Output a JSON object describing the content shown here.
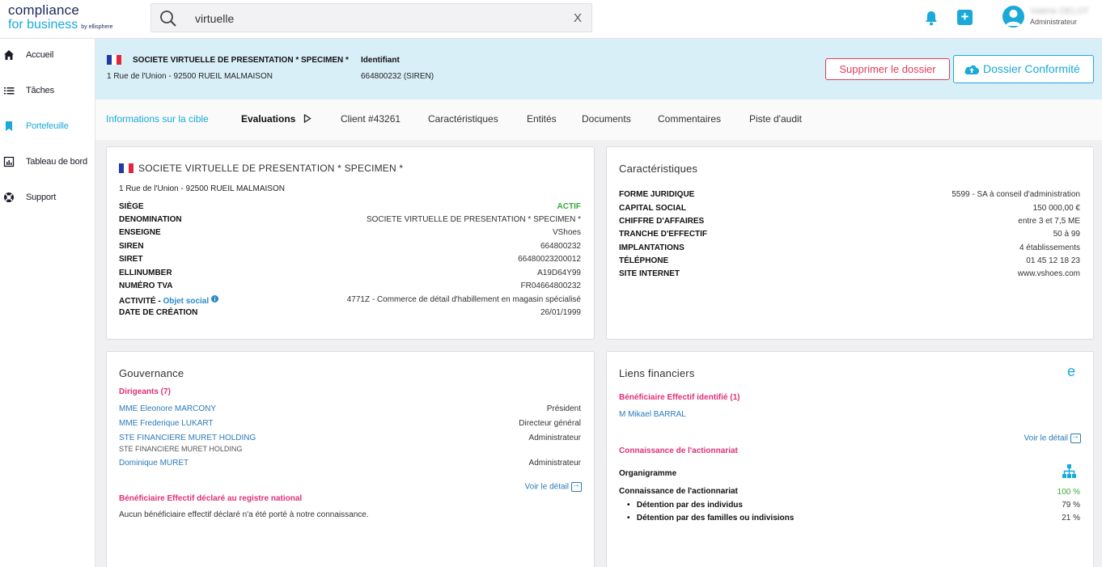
{
  "app": {
    "logo_line1": "compliance",
    "logo_line2": "for business",
    "logo_by": "by ellisphere"
  },
  "search": {
    "value": "virtuelle",
    "clear_label": "X"
  },
  "user": {
    "name": "Valérie DELOT",
    "role": "Administrateur"
  },
  "sidebar": {
    "items": [
      {
        "label": "Accueil",
        "icon": "home-icon"
      },
      {
        "label": "Tâches",
        "icon": "tasks-icon"
      },
      {
        "label": "Portefeuille",
        "icon": "bookmark-icon",
        "active": true
      },
      {
        "label": "Tableau de bord",
        "icon": "dashboard-icon"
      },
      {
        "label": "Support",
        "icon": "lifebuoy-icon"
      }
    ]
  },
  "banner": {
    "company": "SOCIETE VIRTUELLE DE PRESENTATION * SPECIMEN *",
    "address": "1 Rue de l'Union - 92500 RUEIL MALMAISON",
    "id_label": "Identifiant",
    "id_value": "664800232 (SIREN)",
    "delete_label": "Supprimer le dossier",
    "conform_label": "Dossier Conformité"
  },
  "tabs": [
    "Informations sur la cible",
    "Evaluations",
    "Client #43261",
    "Caractéristiques",
    "Entités",
    "Documents",
    "Commentaires",
    "Piste d'audit"
  ],
  "identity": {
    "title": "SOCIETE VIRTUELLE DE PRESENTATION * SPECIMEN *",
    "address": "1 Rue de l'Union - 92500 RUEIL MALMAISON",
    "rows": [
      {
        "label": "SIÈGE",
        "value": "ACTIF"
      },
      {
        "label": "DENOMINATION",
        "value": "SOCIETE VIRTUELLE DE PRESENTATION * SPECIMEN *"
      },
      {
        "label": "ENSEIGNE",
        "value": "VShoes"
      },
      {
        "label": "SIREN",
        "value": "664800232"
      },
      {
        "label": "SIRET",
        "value": "66480023200012"
      },
      {
        "label": "ELLINUMBER",
        "value": "A19D64Y99"
      },
      {
        "label": "NUMÉRO TVA",
        "value": "FR04664800232"
      },
      {
        "label": "ACTIVITÉ -",
        "value": "4771Z - Commerce de détail d'habillement en magasin spécialisé"
      },
      {
        "label": "DATE DE CRÉATION",
        "value": "26/01/1999"
      }
    ],
    "objet_social": "Objet social",
    "active_color": "#3aa83a"
  },
  "caracteristiques": {
    "title": "Caractéristiques",
    "rows": [
      {
        "label": "FORME JURIDIQUE",
        "value": "5599 - SA à conseil d'administration"
      },
      {
        "label": "CAPITAL SOCIAL",
        "value": "150 000,00 €"
      },
      {
        "label": "CHIFFRE D'AFFAIRES",
        "value": "entre 3 et 7,5 ME"
      },
      {
        "label": "TRANCHE D'EFFECTIF",
        "value": "50 à 99"
      },
      {
        "label": "IMPLANTATIONS",
        "value": "4 établissements"
      },
      {
        "label": "TÉLÉPHONE",
        "value": "01 45 12 18 23"
      },
      {
        "label": "SITE INTERNET",
        "value": "www.vshoes.com"
      }
    ]
  },
  "gouvernance": {
    "title": "Gouvernance",
    "dirigeants_label": "Dirigeants (7)",
    "dirigeants": [
      {
        "name": "MME Eleonore MARCONY",
        "role": "Président",
        "sub": ""
      },
      {
        "name": "MME Frederique LUKART",
        "role": "Directeur général",
        "sub": ""
      },
      {
        "name": "STE FINANCIERE MURET HOLDING",
        "role": "Administrateur",
        "sub": "STE FINANCIERE MURET HOLDING"
      },
      {
        "name": "Dominique MURET",
        "role": "Administrateur",
        "sub": ""
      }
    ],
    "detail_label": "Voir le détail",
    "beneficiaire_label": "Bénéficiaire Effectif déclaré au registre national",
    "beneficiaire_text": "Aucun bénéficiaire effectif déclaré n'a été porté à notre connaissance."
  },
  "liens": {
    "title": "Liens financiers",
    "e_label": "e",
    "beneficiaire_label": "Bénéficiaire Effectif identifié (1)",
    "beneficiaire_name": "M Mikael BARRAL",
    "detail_label": "Voir le détail",
    "connaissance_label": "Connaissance de l'actionnariat",
    "organigramme_label": "Organigramme",
    "rows": [
      {
        "label": "Connaissance de l'actionnariat",
        "value": "100 %",
        "bullet": false
      },
      {
        "label": "Détention par des individus",
        "value": "79 %",
        "bullet": true
      },
      {
        "label": "Détention par des familles ou indivisions",
        "value": "21 %",
        "bullet": true
      }
    ]
  },
  "colors": {
    "accent": "#1aa9d8",
    "pink": "#e0307a",
    "danger": "#e23c5a",
    "banner": "#d9eff8"
  }
}
